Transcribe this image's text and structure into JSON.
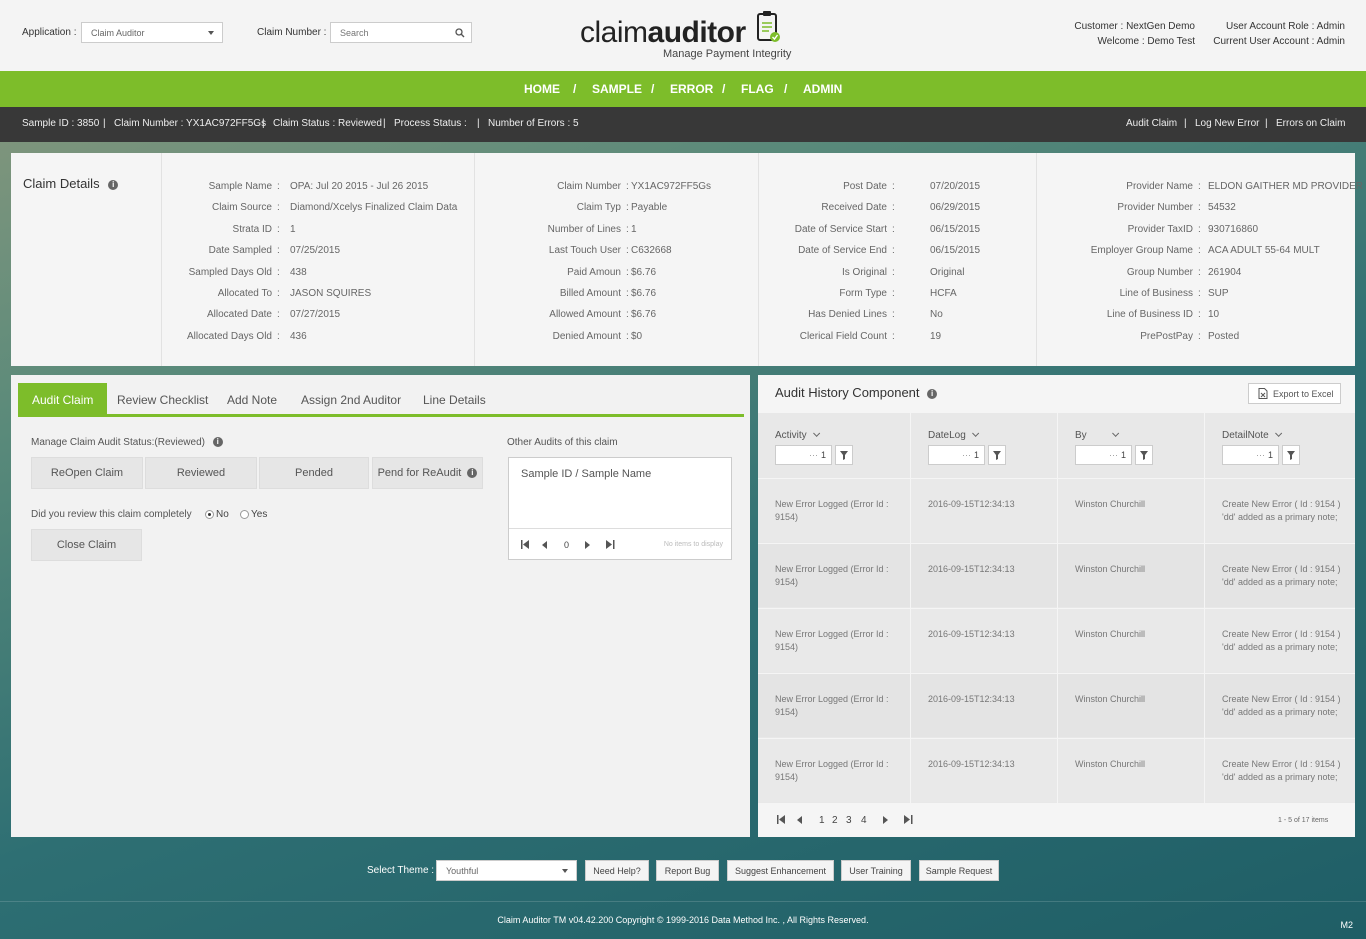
{
  "header": {
    "application_label": "Application :",
    "application_value": "Claim Auditor",
    "claim_number_label": "Claim Number :",
    "claim_search_placeholder": "Search",
    "logo_light": "claim",
    "logo_bold": "auditor",
    "logo_tagline": "Manage Payment Integrity",
    "customer": "Customer : NextGen Demo",
    "welcome": "Welcome : Demo Test",
    "role": "User Account Role : Admin",
    "current": "Current User Account : Admin"
  },
  "nav": {
    "items": [
      "HOME",
      "SAMPLE",
      "ERROR",
      "FLAG",
      "ADMIN"
    ],
    "separator": "/"
  },
  "status_bar": {
    "sample_id": "Sample ID : 3850",
    "claim_number": "Claim Number : YX1AC972FF5Gs",
    "claim_status": "Claim Status : Reviewed",
    "process_status": "Process Status :",
    "errors": "Number of Errors : 5",
    "sep": "|",
    "links": [
      "Audit Claim",
      "Log New Error",
      "Errors on Claim"
    ]
  },
  "claim_details": {
    "title": "Claim Details",
    "columns": [
      [
        {
          "k": "Sample Name",
          "v": "OPA: Jul 20 2015 - Jul 26 2015"
        },
        {
          "k": "Claim Source",
          "v": "Diamond/Xcelys Finalized Claim Data"
        },
        {
          "k": "Strata ID",
          "v": "1"
        },
        {
          "k": "Date Sampled",
          "v": "07/25/2015"
        },
        {
          "k": "Sampled Days Old",
          "v": "438"
        },
        {
          "k": "Allocated To",
          "v": "JASON SQUIRES"
        },
        {
          "k": "Allocated Date",
          "v": "07/27/2015"
        },
        {
          "k": "Allocated Days Old",
          "v": "436"
        }
      ],
      [
        {
          "k": "Claim Number",
          "v": "YX1AC972FF5Gs"
        },
        {
          "k": "Claim Typ",
          "v": "Payable"
        },
        {
          "k": "Number of Lines",
          "v": "1"
        },
        {
          "k": "Last Touch User",
          "v": "C632668"
        },
        {
          "k": "Paid Amoun",
          "v": "$6.76"
        },
        {
          "k": "Billed Amount",
          "v": "$6.76"
        },
        {
          "k": "Allowed Amount",
          "v": "$6.76"
        },
        {
          "k": "Denied Amount",
          "v": "$0"
        }
      ],
      [
        {
          "k": "Post Date",
          "v": "07/20/2015"
        },
        {
          "k": "Received Date",
          "v": "06/29/2015"
        },
        {
          "k": "Date of Service Start",
          "v": "06/15/2015"
        },
        {
          "k": "Date of Service End",
          "v": "06/15/2015"
        },
        {
          "k": "Is Original",
          "v": "Original"
        },
        {
          "k": "Form Type",
          "v": "HCFA"
        },
        {
          "k": "Has Denied Lines",
          "v": "No"
        },
        {
          "k": "Clerical Field Count",
          "v": "19"
        }
      ],
      [
        {
          "k": "Provider Name",
          "v": "ELDON GAITHER MD PROVIDER"
        },
        {
          "k": "Provider Number",
          "v": "54532"
        },
        {
          "k": "Provider TaxID",
          "v": "930716860"
        },
        {
          "k": "Employer Group Name",
          "v": "ACA ADULT 55-64 MULT"
        },
        {
          "k": "Group Number",
          "v": "261904"
        },
        {
          "k": "Line of Business",
          "v": "SUP"
        },
        {
          "k": "Line of Business ID",
          "v": "10"
        },
        {
          "k": "PrePostPay",
          "v": "Posted"
        }
      ]
    ],
    "colon": ":"
  },
  "audit_panel": {
    "tabs": [
      "Audit Claim",
      "Review Checklist",
      "Add Note",
      "Assign 2nd Auditor",
      "Line Details"
    ],
    "manage_label": "Manage Claim Audit Status:(Reviewed)",
    "status_buttons": [
      "ReOpen Claim",
      "Reviewed",
      "Pended",
      "Pend for ReAudit"
    ],
    "review_question": "Did you review this claim completely",
    "radio_no": "No",
    "radio_yes": "Yes",
    "close_button": "Close Claim",
    "other_audits_label": "Other Audits of this claim",
    "other_audits_header": "Sample ID / Sample Name",
    "pager_page": "0",
    "no_items": "No items to display"
  },
  "history_panel": {
    "title": "Audit History Component",
    "export_button": "Export to Excel",
    "columns": [
      "Activity",
      "DateLog",
      "By",
      "DetailNote"
    ],
    "filter_value": "1",
    "filter_prefix": "···",
    "rows": [
      {
        "activity": "New Error Logged (Error Id : 9154)",
        "datelog": "2016-09-15T12:34:13",
        "by": "Winston Churchill",
        "note": "Create New Error ( Id : 9154 ) 'dd' added as a primary note;"
      },
      {
        "activity": "New Error Logged (Error Id : 9154)",
        "datelog": "2016-09-15T12:34:13",
        "by": "Winston Churchill",
        "note": "Create New Error ( Id : 9154 ) 'dd' added as a primary note;"
      },
      {
        "activity": "New Error Logged (Error Id : 9154)",
        "datelog": "2016-09-15T12:34:13",
        "by": "Winston Churchill",
        "note": "Create New Error ( Id : 9154 ) 'dd' added as a primary note;"
      },
      {
        "activity": "New Error Logged (Error Id : 9154)",
        "datelog": "2016-09-15T12:34:13",
        "by": "Winston Churchill",
        "note": "Create New Error ( Id : 9154 ) 'dd' added as a primary note;"
      },
      {
        "activity": "New Error Logged (Error Id : 9154)",
        "datelog": "2016-09-15T12:34:13",
        "by": "Winston Churchill",
        "note": "Create New Error ( Id : 9154 ) 'dd' added as a primary note;"
      }
    ],
    "pages": [
      "1",
      "2",
      "3",
      "4"
    ],
    "items_summary": "1 - 5 of 17 items"
  },
  "footer": {
    "theme_label": "Select Theme :",
    "theme_value": "Youthful",
    "buttons": [
      "Need Help?",
      "Report Bug",
      "Suggest Enhancement",
      "User Training",
      "Sample Request"
    ],
    "copyright": "Claim Auditor TM v04.42.200 Copyright © 1999-2016 Data Method Inc. , All Rights Reserved.",
    "badge": "M2"
  },
  "colors": {
    "accent": "#7dbd2a",
    "status_bar": "#383838"
  },
  "icons": [
    "chevron-down-icon",
    "search-icon",
    "clipboard-check-icon",
    "info-icon",
    "filter-icon",
    "excel-icon",
    "pager-first-icon",
    "pager-prev-icon",
    "pager-next-icon",
    "pager-last-icon"
  ]
}
